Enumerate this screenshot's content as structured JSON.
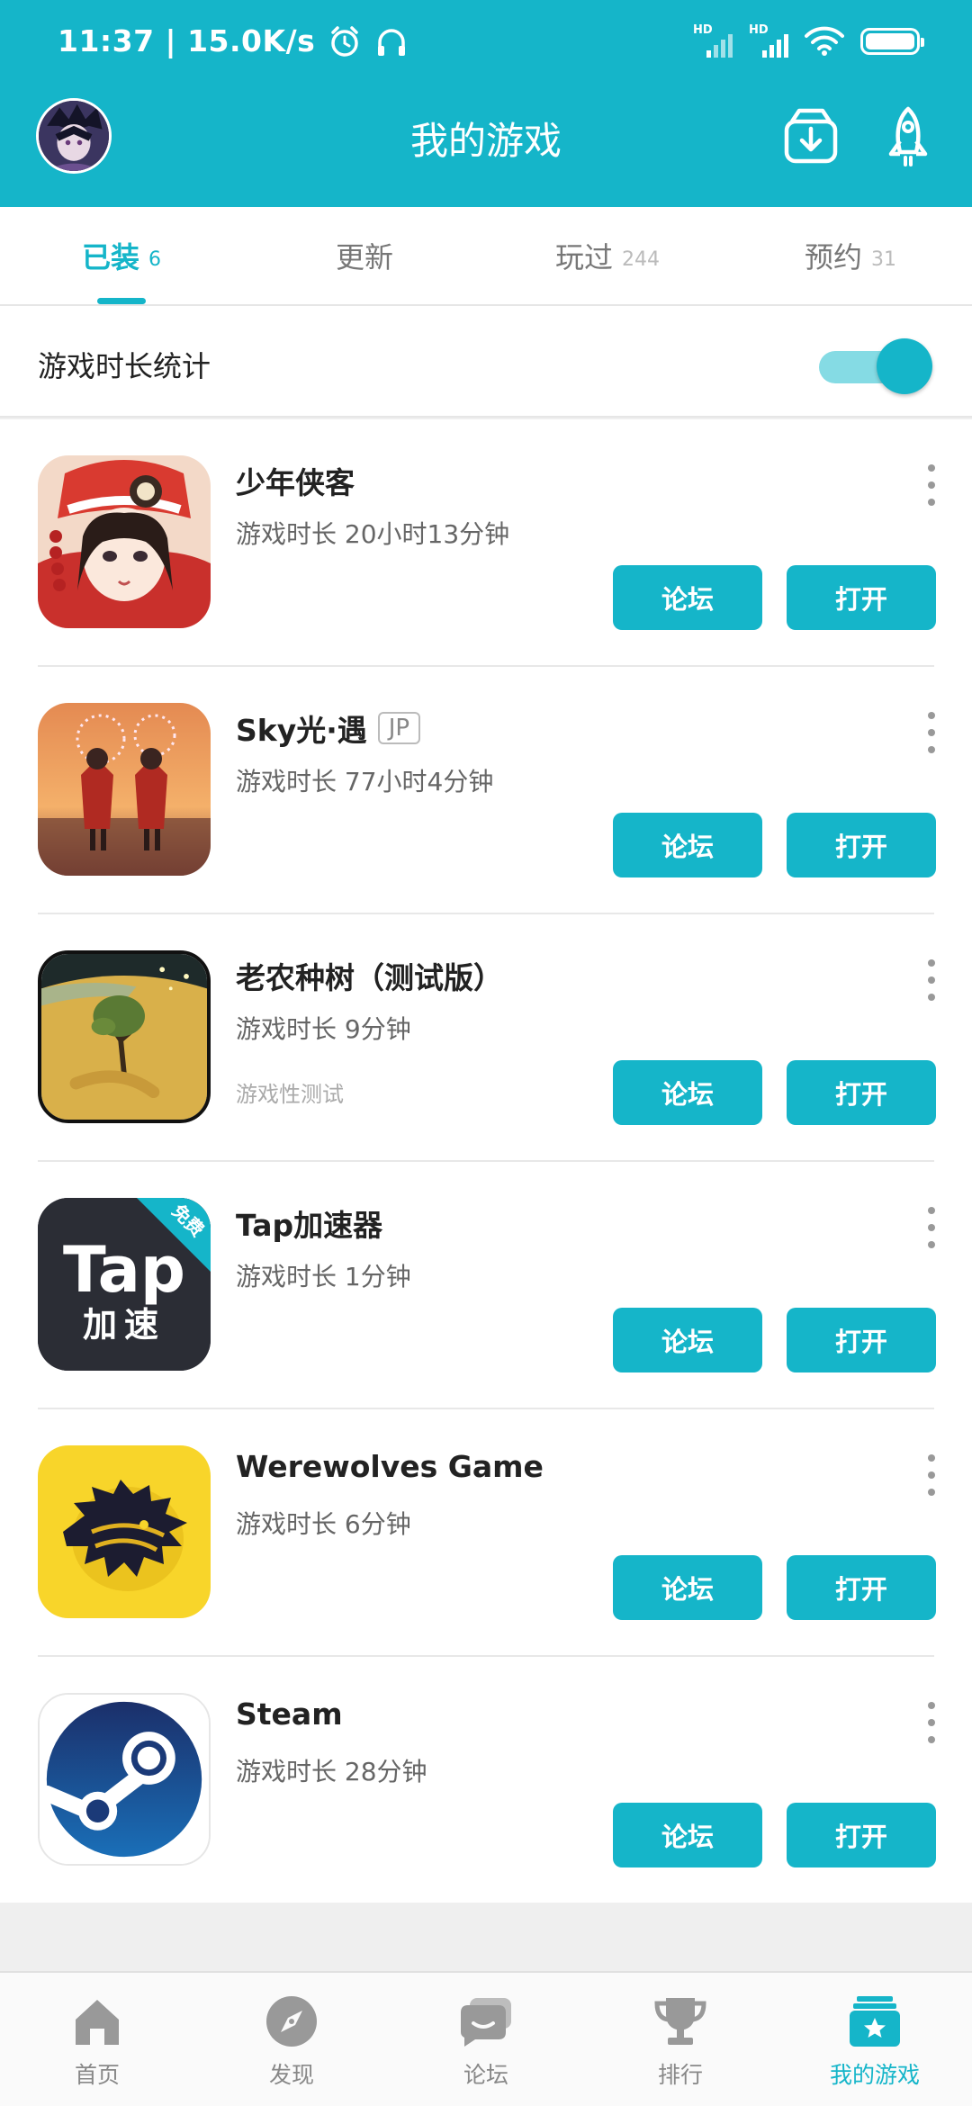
{
  "status_bar": {
    "time_speed": "11:37 | 15.0K/s",
    "signal_1_label": "HD",
    "signal_2_label": "HD"
  },
  "header": {
    "title": "我的游戏"
  },
  "tabs": [
    {
      "label": "已装",
      "count": "6",
      "active": true
    },
    {
      "label": "更新",
      "count": "",
      "active": false
    },
    {
      "label": "玩过",
      "count": "244",
      "active": false
    },
    {
      "label": "预约",
      "count": "31",
      "active": false
    }
  ],
  "stats": {
    "label": "游戏时长统计",
    "toggle_on": true
  },
  "games": [
    {
      "name": "少年侠客",
      "region": "",
      "play_time": "游戏时长 20小时13分钟",
      "note": "",
      "forum_label": "论坛",
      "open_label": "打开"
    },
    {
      "name": "Sky光·遇",
      "region": "JP",
      "play_time": "游戏时长 77小时4分钟",
      "note": "",
      "forum_label": "论坛",
      "open_label": "打开"
    },
    {
      "name": "老农种树（测试版）",
      "region": "",
      "play_time": "游戏时长 9分钟",
      "note": "游戏性测试",
      "forum_label": "论坛",
      "open_label": "打开"
    },
    {
      "name": "Tap加速器",
      "region": "",
      "play_time": "游戏时长 1分钟",
      "note": "",
      "forum_label": "论坛",
      "open_label": "打开",
      "icon_text": {
        "main": "Tap",
        "sub": "加速",
        "badge": "免费"
      }
    },
    {
      "name": "Werewolves Game",
      "region": "",
      "play_time": "游戏时长 6分钟",
      "note": "",
      "forum_label": "论坛",
      "open_label": "打开"
    },
    {
      "name": "Steam",
      "region": "",
      "play_time": "游戏时长 28分钟",
      "note": "",
      "forum_label": "论坛",
      "open_label": "打开"
    }
  ],
  "bottom_nav": [
    {
      "label": "首页",
      "icon": "home-icon",
      "active": false
    },
    {
      "label": "发现",
      "icon": "compass-icon",
      "active": false
    },
    {
      "label": "论坛",
      "icon": "forum-icon",
      "active": false
    },
    {
      "label": "排行",
      "icon": "trophy-icon",
      "active": false
    },
    {
      "label": "我的游戏",
      "icon": "my-games-icon",
      "active": true
    }
  ],
  "colors": {
    "accent": "#15b5c9",
    "accent_light": "#85dbe4",
    "nav_inactive": "#999999"
  }
}
